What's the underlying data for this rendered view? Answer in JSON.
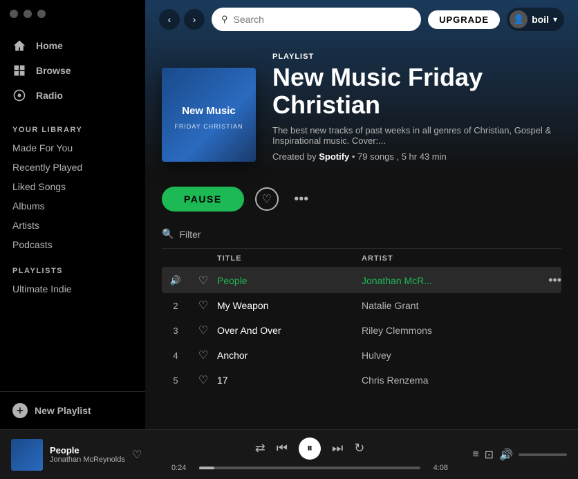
{
  "titlebar": {
    "dots": [
      "dot1",
      "dot2",
      "dot3"
    ]
  },
  "topbar": {
    "search_placeholder": "Search",
    "upgrade_label": "UPGRADE",
    "user_name": "boil"
  },
  "sidebar": {
    "nav_items": [
      {
        "id": "home",
        "label": "Home",
        "icon": "home-icon"
      },
      {
        "id": "browse",
        "label": "Browse",
        "icon": "browse-icon"
      },
      {
        "id": "radio",
        "label": "Radio",
        "icon": "radio-icon"
      }
    ],
    "library_title": "YOUR LIBRARY",
    "library_items": [
      {
        "id": "made-for-you",
        "label": "Made For You"
      },
      {
        "id": "recently-played",
        "label": "Recently Played"
      },
      {
        "id": "liked-songs",
        "label": "Liked Songs"
      },
      {
        "id": "albums",
        "label": "Albums"
      },
      {
        "id": "artists",
        "label": "Artists"
      },
      {
        "id": "podcasts",
        "label": "Podcasts"
      }
    ],
    "playlists_title": "PLAYLISTS",
    "playlists": [
      {
        "id": "ultimate-indie",
        "label": "Ultimate Indie"
      }
    ],
    "new_playlist_label": "New Playlist"
  },
  "playlist": {
    "type_label": "PLAYLIST",
    "title": "New Music Friday Christian",
    "cover_title": "New Music",
    "cover_subtitle": "FRIDAY CHRISTIAN",
    "description": "The best new tracks of past weeks in all genres of Christian, Gospel & Inspirational music. Cover:...",
    "created_by": "Created by",
    "creator": "Spotify",
    "song_count": "79 songs",
    "duration": "5 hr 43 min",
    "pause_label": "PAUSE",
    "filter_label": "Filter"
  },
  "track_list": {
    "col_title": "TITLE",
    "col_artist": "ARTIST",
    "tracks": [
      {
        "num": "▶",
        "title": "People",
        "artist": "Jonathan McR...",
        "active": true,
        "liked": false
      },
      {
        "num": "2",
        "title": "My Weapon",
        "artist": "Natalie Grant",
        "active": false,
        "liked": false
      },
      {
        "num": "3",
        "title": "Over And Over",
        "artist": "Riley Clemmons",
        "active": false,
        "liked": false
      },
      {
        "num": "4",
        "title": "Anchor",
        "artist": "Hulvey",
        "active": false,
        "liked": false
      },
      {
        "num": "5",
        "title": "17",
        "artist": "Chris Renzema",
        "active": false,
        "liked": false
      }
    ]
  },
  "player": {
    "song_name": "People",
    "artist_name": "Jonathan McReynolds",
    "current_time": "0:24",
    "total_time": "4:08",
    "progress_percent": 7
  }
}
